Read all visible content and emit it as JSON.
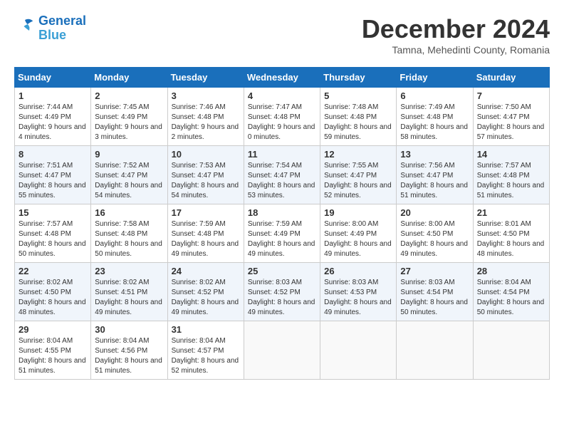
{
  "logo": {
    "line1": "General",
    "line2": "Blue"
  },
  "title": "December 2024",
  "subtitle": "Tamna, Mehedinti County, Romania",
  "days_of_week": [
    "Sunday",
    "Monday",
    "Tuesday",
    "Wednesday",
    "Thursday",
    "Friday",
    "Saturday"
  ],
  "weeks": [
    [
      {
        "day": "1",
        "sunrise": "7:44 AM",
        "sunset": "4:49 PM",
        "daylight": "9 hours and 4 minutes."
      },
      {
        "day": "2",
        "sunrise": "7:45 AM",
        "sunset": "4:49 PM",
        "daylight": "9 hours and 3 minutes."
      },
      {
        "day": "3",
        "sunrise": "7:46 AM",
        "sunset": "4:48 PM",
        "daylight": "9 hours and 2 minutes."
      },
      {
        "day": "4",
        "sunrise": "7:47 AM",
        "sunset": "4:48 PM",
        "daylight": "9 hours and 0 minutes."
      },
      {
        "day": "5",
        "sunrise": "7:48 AM",
        "sunset": "4:48 PM",
        "daylight": "8 hours and 59 minutes."
      },
      {
        "day": "6",
        "sunrise": "7:49 AM",
        "sunset": "4:48 PM",
        "daylight": "8 hours and 58 minutes."
      },
      {
        "day": "7",
        "sunrise": "7:50 AM",
        "sunset": "4:47 PM",
        "daylight": "8 hours and 57 minutes."
      }
    ],
    [
      {
        "day": "8",
        "sunrise": "7:51 AM",
        "sunset": "4:47 PM",
        "daylight": "8 hours and 55 minutes."
      },
      {
        "day": "9",
        "sunrise": "7:52 AM",
        "sunset": "4:47 PM",
        "daylight": "8 hours and 54 minutes."
      },
      {
        "day": "10",
        "sunrise": "7:53 AM",
        "sunset": "4:47 PM",
        "daylight": "8 hours and 54 minutes."
      },
      {
        "day": "11",
        "sunrise": "7:54 AM",
        "sunset": "4:47 PM",
        "daylight": "8 hours and 53 minutes."
      },
      {
        "day": "12",
        "sunrise": "7:55 AM",
        "sunset": "4:47 PM",
        "daylight": "8 hours and 52 minutes."
      },
      {
        "day": "13",
        "sunrise": "7:56 AM",
        "sunset": "4:47 PM",
        "daylight": "8 hours and 51 minutes."
      },
      {
        "day": "14",
        "sunrise": "7:57 AM",
        "sunset": "4:48 PM",
        "daylight": "8 hours and 51 minutes."
      }
    ],
    [
      {
        "day": "15",
        "sunrise": "7:57 AM",
        "sunset": "4:48 PM",
        "daylight": "8 hours and 50 minutes."
      },
      {
        "day": "16",
        "sunrise": "7:58 AM",
        "sunset": "4:48 PM",
        "daylight": "8 hours and 50 minutes."
      },
      {
        "day": "17",
        "sunrise": "7:59 AM",
        "sunset": "4:48 PM",
        "daylight": "8 hours and 49 minutes."
      },
      {
        "day": "18",
        "sunrise": "7:59 AM",
        "sunset": "4:49 PM",
        "daylight": "8 hours and 49 minutes."
      },
      {
        "day": "19",
        "sunrise": "8:00 AM",
        "sunset": "4:49 PM",
        "daylight": "8 hours and 49 minutes."
      },
      {
        "day": "20",
        "sunrise": "8:00 AM",
        "sunset": "4:50 PM",
        "daylight": "8 hours and 49 minutes."
      },
      {
        "day": "21",
        "sunrise": "8:01 AM",
        "sunset": "4:50 PM",
        "daylight": "8 hours and 48 minutes."
      }
    ],
    [
      {
        "day": "22",
        "sunrise": "8:02 AM",
        "sunset": "4:50 PM",
        "daylight": "8 hours and 48 minutes."
      },
      {
        "day": "23",
        "sunrise": "8:02 AM",
        "sunset": "4:51 PM",
        "daylight": "8 hours and 49 minutes."
      },
      {
        "day": "24",
        "sunrise": "8:02 AM",
        "sunset": "4:52 PM",
        "daylight": "8 hours and 49 minutes."
      },
      {
        "day": "25",
        "sunrise": "8:03 AM",
        "sunset": "4:52 PM",
        "daylight": "8 hours and 49 minutes."
      },
      {
        "day": "26",
        "sunrise": "8:03 AM",
        "sunset": "4:53 PM",
        "daylight": "8 hours and 49 minutes."
      },
      {
        "day": "27",
        "sunrise": "8:03 AM",
        "sunset": "4:54 PM",
        "daylight": "8 hours and 50 minutes."
      },
      {
        "day": "28",
        "sunrise": "8:04 AM",
        "sunset": "4:54 PM",
        "daylight": "8 hours and 50 minutes."
      }
    ],
    [
      {
        "day": "29",
        "sunrise": "8:04 AM",
        "sunset": "4:55 PM",
        "daylight": "8 hours and 51 minutes."
      },
      {
        "day": "30",
        "sunrise": "8:04 AM",
        "sunset": "4:56 PM",
        "daylight": "8 hours and 51 minutes."
      },
      {
        "day": "31",
        "sunrise": "8:04 AM",
        "sunset": "4:57 PM",
        "daylight": "8 hours and 52 minutes."
      },
      null,
      null,
      null,
      null
    ]
  ]
}
